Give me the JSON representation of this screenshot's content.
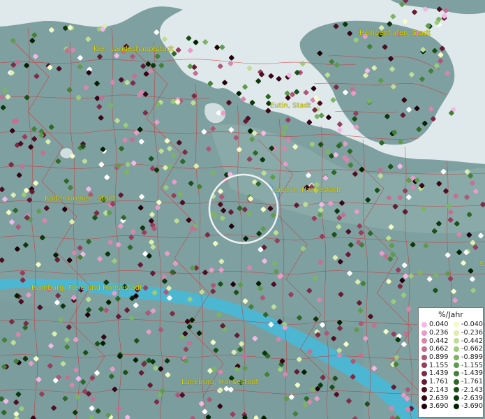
{
  "map": {
    "cities": [
      {
        "label": "Kiel, Landeshauptstadt"
      },
      {
        "label": "Heiligenhafen, Stadt"
      },
      {
        "label": "Eutin, Stadt"
      },
      {
        "label": "Lübeck, Hansestadt"
      },
      {
        "label": "Kaltenkirchen, Stadt"
      },
      {
        "label": "Hamburg, Freie und Hansestadt"
      },
      {
        "label": "Lüneburg, Hansestadt"
      },
      {
        "label": "S"
      }
    ]
  },
  "legend": {
    "title": "%/Jahr",
    "positive": [
      {
        "value": "0.040",
        "color": "#f4b8e6"
      },
      {
        "value": "0.236",
        "color": "#e89cc8"
      },
      {
        "value": "0.442",
        "color": "#d886ad"
      },
      {
        "value": "0.662",
        "color": "#c47093"
      },
      {
        "value": "0.899",
        "color": "#ae5878"
      },
      {
        "value": "1.155",
        "color": "#963f5d"
      },
      {
        "value": "1.439",
        "color": "#7d2c47"
      },
      {
        "value": "1.761",
        "color": "#651b33"
      },
      {
        "value": "2.143",
        "color": "#4e0f22"
      },
      {
        "value": "2.639",
        "color": "#380614"
      },
      {
        "value": "3.690",
        "color": "#22000a"
      }
    ],
    "negative": [
      {
        "value": "-0.040",
        "color": "#f4fbc4"
      },
      {
        "value": "-0.236",
        "color": "#dcedae"
      },
      {
        "value": "-0.442",
        "color": "#bedd95"
      },
      {
        "value": "-0.662",
        "color": "#9ccb7c"
      },
      {
        "value": "-0.899",
        "color": "#7cb464"
      },
      {
        "value": "-1.155",
        "color": "#5e9b4e"
      },
      {
        "value": "-1.439",
        "color": "#448138"
      },
      {
        "value": "-1.761",
        "color": "#2e6828"
      },
      {
        "value": "-2.143",
        "color": "#1c5019"
      },
      {
        "value": "-2.639",
        "color": "#0c380c"
      },
      {
        "value": "-3.690",
        "color": "#002000"
      }
    ]
  }
}
